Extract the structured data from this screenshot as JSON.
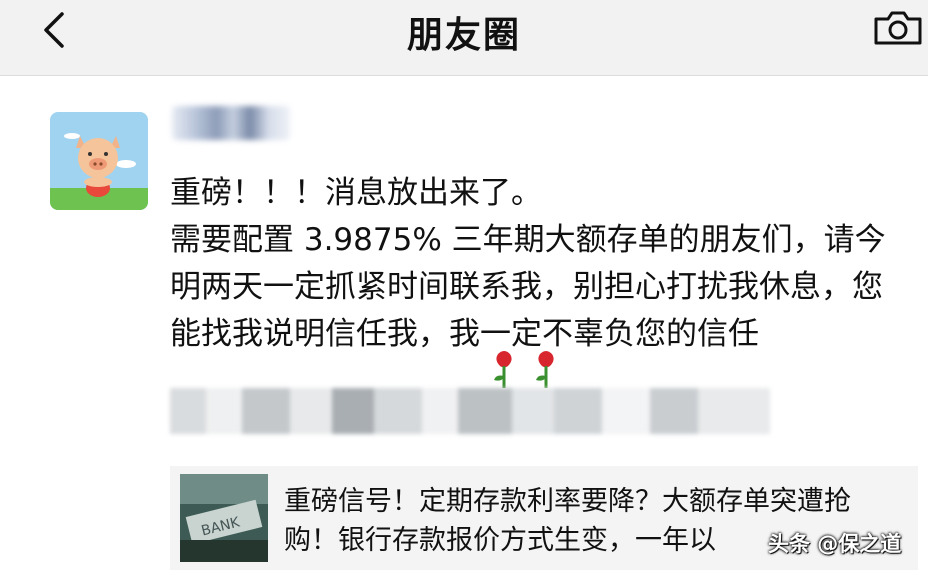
{
  "nav": {
    "title": "朋友圈",
    "back_icon": "chevron-left-icon",
    "camera_icon": "camera-icon"
  },
  "post": {
    "avatar_icon": "pig-avatar",
    "body": "重磅！！！消息放出来了。\n需要配置 3.9875% 三年期大额存单的朋友们，请今明两天一定抓紧时间联系我，别担心打扰我休息，您能找我说明信任我，我一定不辜负您的信任",
    "emoji": "rose-emoji"
  },
  "link_card": {
    "title": "重磅信号！定期存款利率要降？大额存单突遭抢购！银行存款报价方式生变，一年以",
    "thumbnail_text": "BANK"
  },
  "watermark": "头条 @保之道",
  "colors": {
    "nav_bg": "#f2f2f2",
    "card_bg": "#f4f4f4",
    "text": "#111111"
  }
}
